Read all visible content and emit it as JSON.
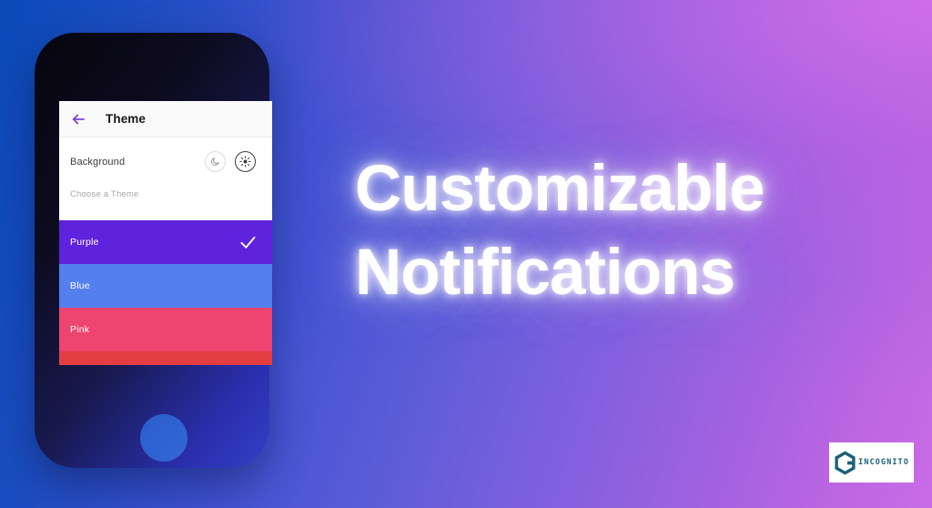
{
  "background": {
    "gradient_from": "#0b4ab8",
    "gradient_mid": "#6a63d8",
    "gradient_to": "#c86ce6"
  },
  "headline": {
    "line1": "Customizable",
    "line2": "Notifications",
    "color": "#ffffff"
  },
  "phone": {
    "frame_color": "#0d0b1e",
    "home_button_color": "#2f63d2",
    "app": {
      "appbar": {
        "back_label": "back-arrow",
        "title": "Theme",
        "back_arrow_color": "#7b42d6",
        "background": "#fafafa"
      },
      "background_setting": {
        "label": "Background",
        "modes": [
          {
            "name": "dark-mode",
            "icon": "moon-icon",
            "selected": false
          },
          {
            "name": "light-mode",
            "icon": "sun-icon",
            "selected": true
          }
        ]
      },
      "choose_theme": {
        "label": "Choose a Theme"
      },
      "themes": [
        {
          "label": "Purple",
          "color": "#5f22dd",
          "selected": true
        },
        {
          "label": "Blue",
          "color": "#5480ef",
          "selected": false
        },
        {
          "label": "Pink",
          "color": "#ee4470",
          "selected": false
        },
        {
          "label": "",
          "color": "#e43e43",
          "selected": false
        }
      ]
    }
  },
  "logo": {
    "word": "INCOGNITO",
    "mark_color": "#1d5f78",
    "box_color": "#ffffff"
  }
}
